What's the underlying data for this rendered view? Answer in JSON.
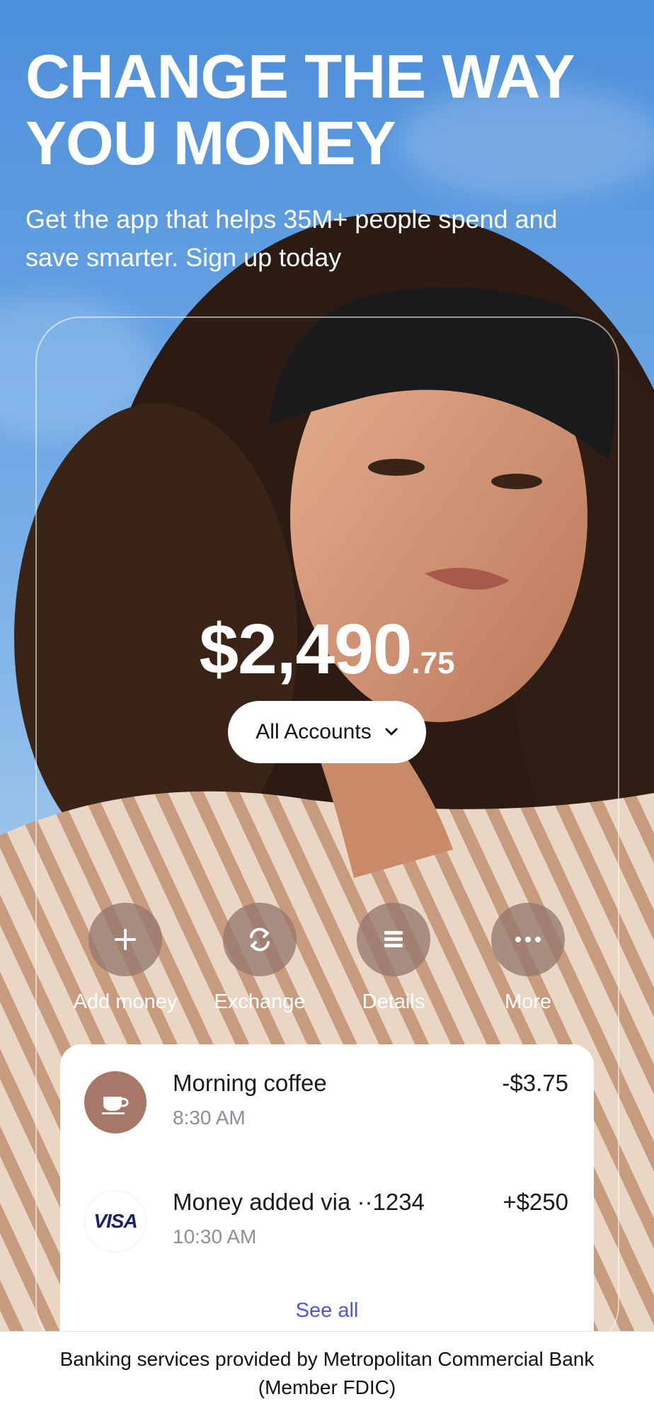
{
  "hero": {
    "headline_line1": "CHANGE THE WAY",
    "headline_line2": "YOU MONEY",
    "subhead_line1": "Get the app that helps 35M+ people spend and",
    "subhead_line2": "save smarter. Sign up today"
  },
  "balance": {
    "main": "$2,490",
    "cents": ".75",
    "accounts_label": "All Accounts",
    "accounts_icon": "chevron-down-icon"
  },
  "actions": [
    {
      "label": "Add money",
      "icon": "plus-icon"
    },
    {
      "label": "Exchange",
      "icon": "exchange-icon"
    },
    {
      "label": "Details",
      "icon": "details-icon"
    },
    {
      "label": "More",
      "icon": "more-icon"
    }
  ],
  "transactions": [
    {
      "title": "Morning coffee",
      "time": "8:30 AM",
      "amount": "-$3.75",
      "icon": "coffee-icon",
      "icon_bg": "#a77868"
    },
    {
      "title": "Money added via ··1234",
      "time": "10:30 AM",
      "amount": "+$250",
      "logo_text": "VISA",
      "icon": "visa-logo",
      "logo_color": "#1a1f71"
    }
  ],
  "see_all_label": "See all",
  "footer": {
    "line1": "Banking services provided by Metropolitan Commercial Bank",
    "line2": "(Member FDIC)"
  },
  "colors": {
    "sky": "#5b95d6",
    "link": "#4f55e0",
    "action_circle": "#96786e"
  }
}
